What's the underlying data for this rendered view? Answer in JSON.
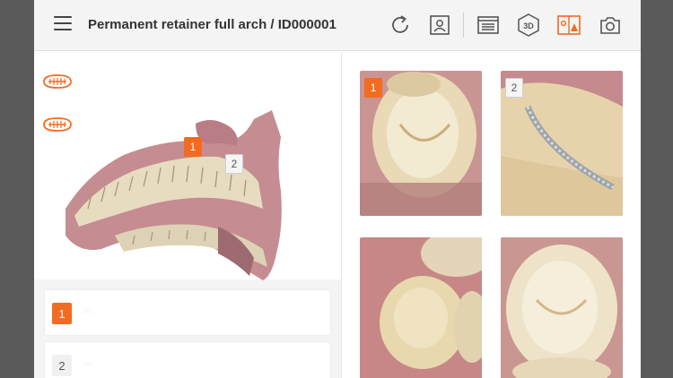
{
  "header": {
    "title": "Permanent retainer full arch / ID000001"
  },
  "toolbar": {
    "items": [
      {
        "icon": "refresh-icon"
      },
      {
        "icon": "patient-info-icon"
      },
      {
        "icon": "document-list-icon"
      },
      {
        "icon": "view-3d-icon",
        "label": "3D"
      },
      {
        "icon": "compare-images-icon"
      },
      {
        "icon": "camera-icon"
      }
    ]
  },
  "viewer": {
    "markers": [
      {
        "label": "1",
        "state": "active"
      },
      {
        "label": "2",
        "state": "inactive"
      }
    ]
  },
  "list": {
    "items": [
      {
        "number": "1",
        "text": "···",
        "state": "active"
      },
      {
        "number": "2",
        "text": "···",
        "state": "inactive"
      }
    ]
  },
  "photos": [
    {
      "label": "1",
      "state": "active"
    },
    {
      "label": "2",
      "state": "inactive"
    },
    {
      "label": "",
      "state": "none"
    },
    {
      "label": "",
      "state": "none"
    }
  ],
  "colors": {
    "accent": "#f26b21",
    "header_bg": "#f4f4f4",
    "frame_bg": "#5a5a5a"
  }
}
